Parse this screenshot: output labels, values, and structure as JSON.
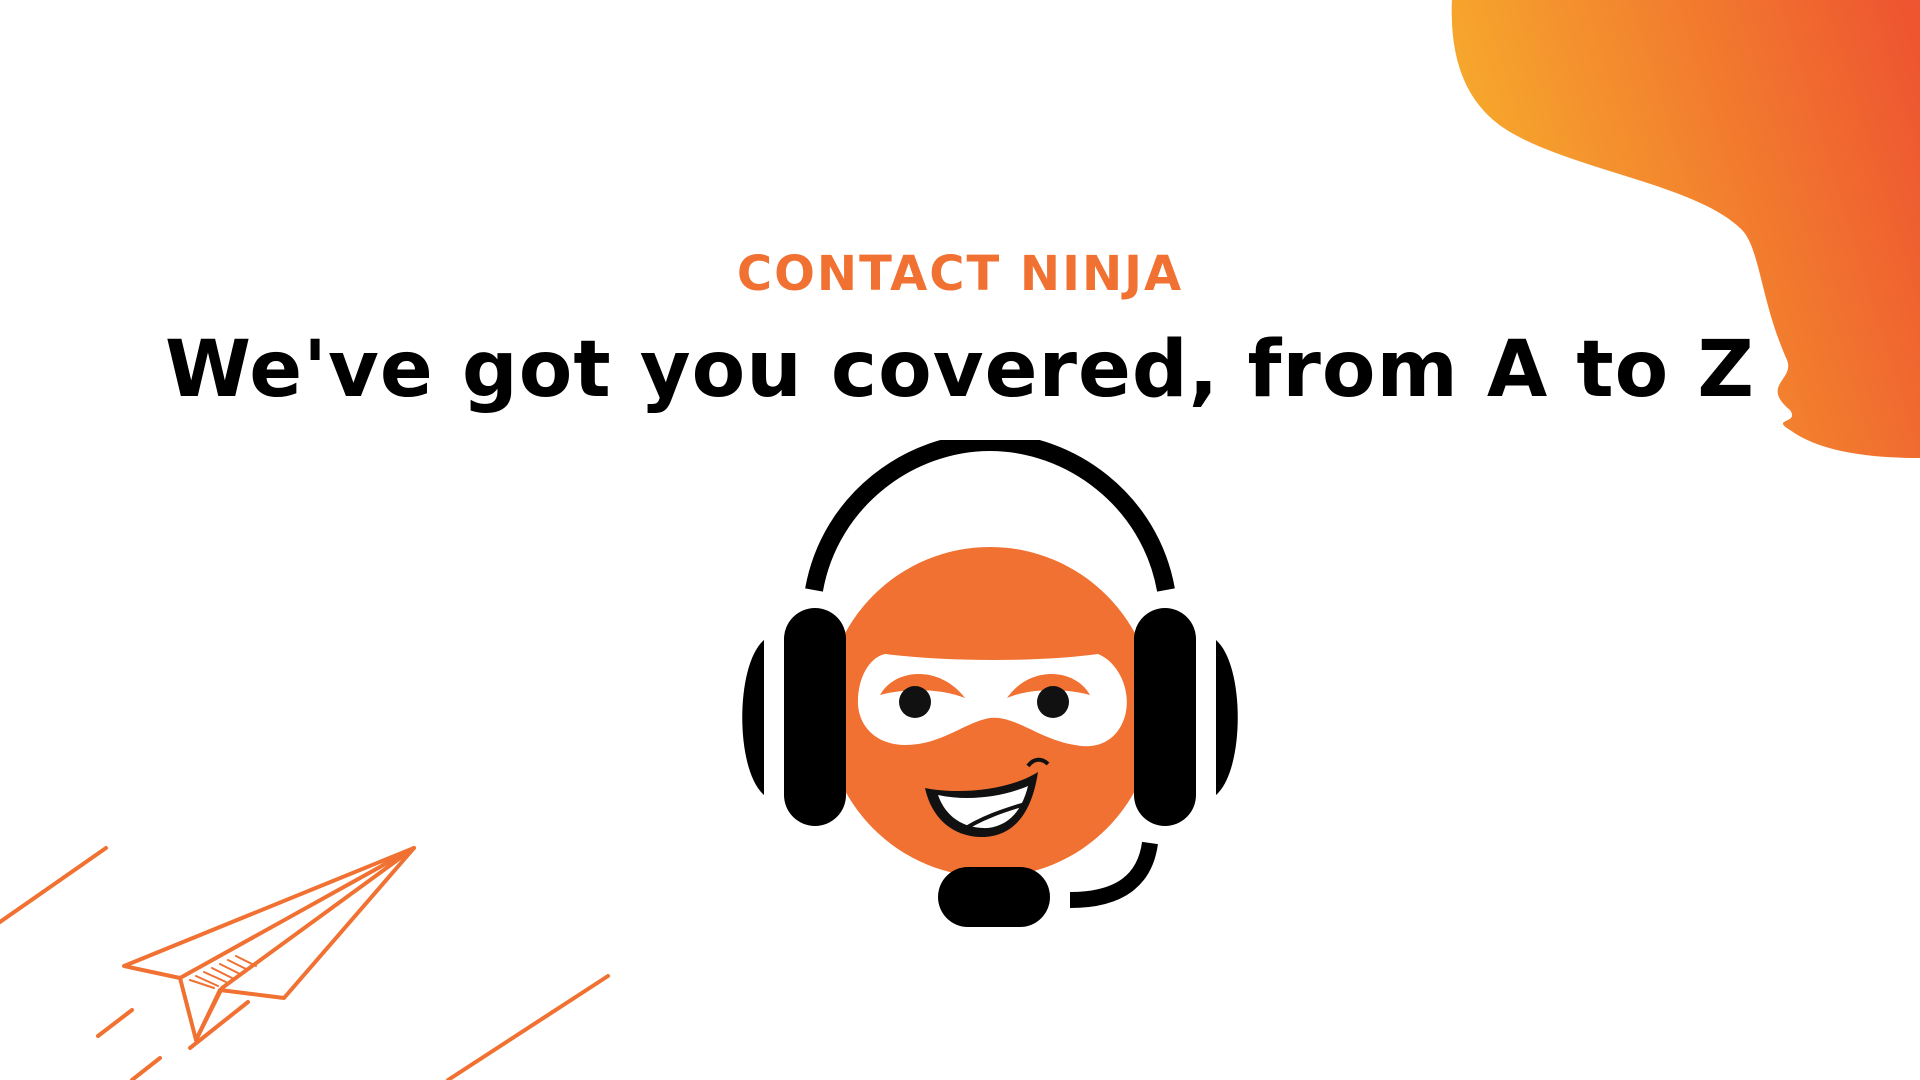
{
  "header": {
    "eyebrow": "CONTACT NINJA",
    "headline": "We've got you covered, from A to Z"
  },
  "colors": {
    "accent": "#F07131",
    "blob_gradient_start": "#F7AE2C",
    "blob_gradient_end": "#EE5530",
    "text": "#000000",
    "background": "#FFFFFF"
  },
  "illustrations": {
    "mascot": "ninja-headset-mascot",
    "decoration": "paper-plane",
    "corner_shape": "orange-gradient-blob"
  }
}
